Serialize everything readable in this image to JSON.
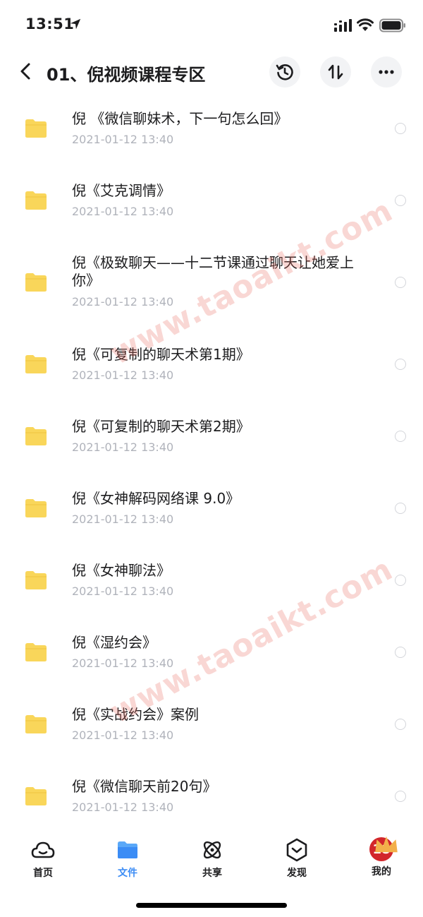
{
  "status_bar": {
    "time": "13:51"
  },
  "header": {
    "title": "01、倪视频课程专区",
    "back_icon": "chevron-left-icon",
    "history_icon": "history-icon",
    "sort_icon": "sort-icon",
    "more_icon": "more-icon"
  },
  "files": [
    {
      "name": "倪 《微信聊妹术，下一句怎么回》",
      "date": "2021-01-12 13:40"
    },
    {
      "name": "倪《艾克调情》",
      "date": "2021-01-12 13:40"
    },
    {
      "name": "倪《极致聊天——十二节课通过聊天让她爱上你》",
      "date": "2021-01-12 13:40"
    },
    {
      "name": "倪《可复制的聊天术第1期》",
      "date": "2021-01-12 13:40"
    },
    {
      "name": "倪《可复制的聊天术第2期》",
      "date": "2021-01-12 13:40"
    },
    {
      "name": "倪《女神解码网络课 9.0》",
      "date": "2021-01-12 13:40"
    },
    {
      "name": "倪《女神聊法》",
      "date": "2021-01-12 13:40"
    },
    {
      "name": "倪《湿约会》",
      "date": "2021-01-12 13:40"
    },
    {
      "name": "倪《实战约会》案例",
      "date": "2021-01-12 13:40"
    },
    {
      "name": "倪《微信聊天前20句》",
      "date": "2021-01-12 13:40"
    }
  ],
  "watermarks": [
    "www.taoaikt.com",
    "www.taoaikt.com"
  ],
  "tabs": [
    {
      "label": "首页",
      "icon": "cloud-home-icon",
      "active": false
    },
    {
      "label": "文件",
      "icon": "folder-icon",
      "active": true
    },
    {
      "label": "共享",
      "icon": "atom-share-icon",
      "active": false
    },
    {
      "label": "发现",
      "icon": "discover-icon",
      "active": false
    },
    {
      "label": "我的",
      "icon": "avatar",
      "active": false
    }
  ],
  "avatar_text": "18",
  "colors": {
    "accent": "#3b8cf5",
    "folder": "#f9d65a",
    "date_text": "#b0b3bb",
    "watermark": "#e86e64"
  }
}
